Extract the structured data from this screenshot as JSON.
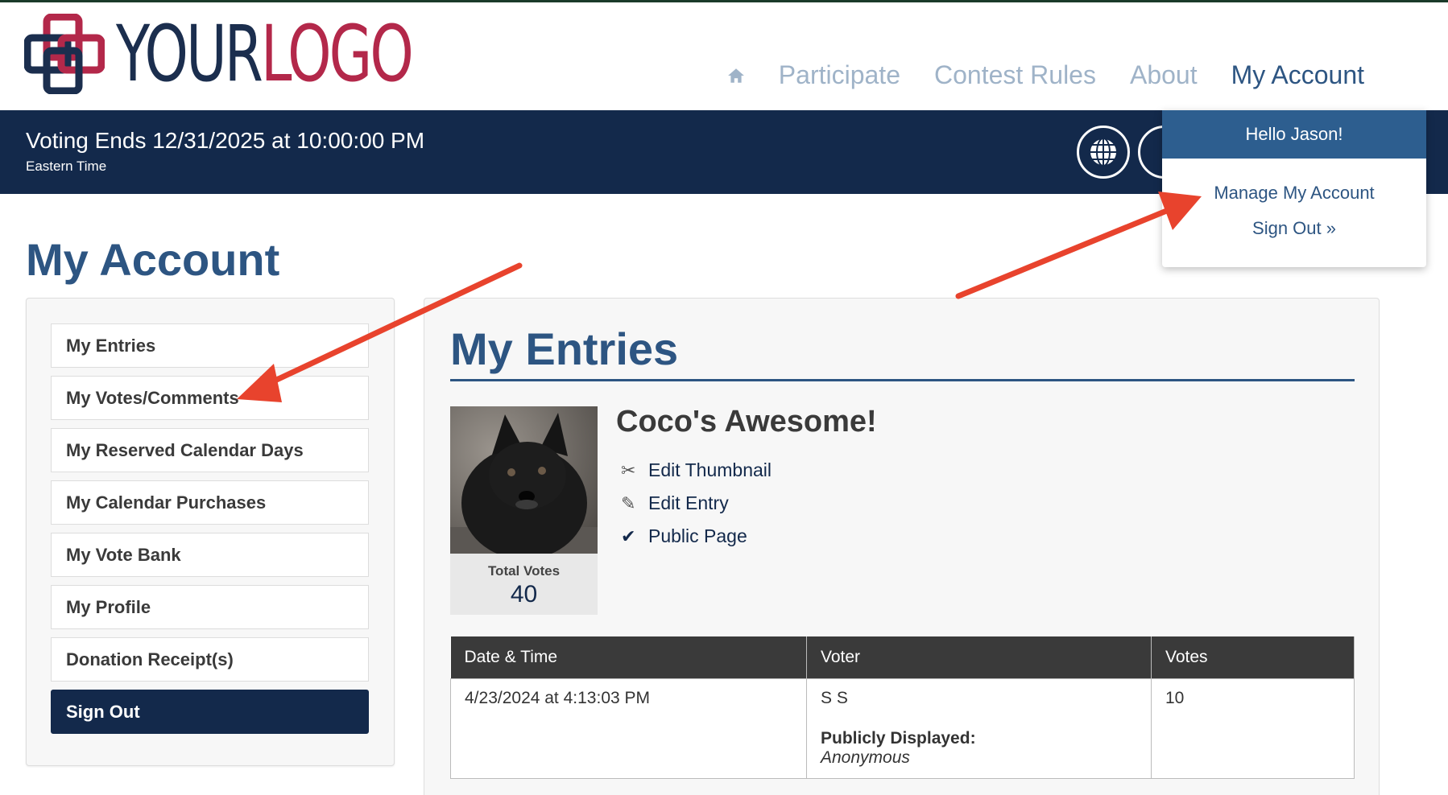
{
  "header": {
    "logo": {
      "part1": "YOUR",
      "part2": "LOGO"
    },
    "nav": [
      {
        "label": "Participate"
      },
      {
        "label": "Contest Rules"
      },
      {
        "label": "About"
      },
      {
        "label": "My Account"
      }
    ]
  },
  "banner": {
    "title": "Voting Ends 12/31/2025 at 10:00:00 PM",
    "subtitle": "Eastern Time"
  },
  "dropdown": {
    "greeting": "Hello Jason!",
    "items": [
      {
        "label": "Manage My Account"
      },
      {
        "label": "Sign Out »"
      }
    ]
  },
  "page": {
    "title": "My Account"
  },
  "sidebar": {
    "items": [
      {
        "label": "My Entries"
      },
      {
        "label": "My Votes/Comments"
      },
      {
        "label": "My Reserved Calendar Days"
      },
      {
        "label": "My Calendar Purchases"
      },
      {
        "label": "My Vote Bank"
      },
      {
        "label": "My Profile"
      },
      {
        "label": "Donation Receipt(s)"
      },
      {
        "label": "Sign Out"
      }
    ]
  },
  "entries": {
    "title": "My Entries",
    "entry": {
      "name": "Coco's Awesome!",
      "total_votes_label": "Total Votes",
      "total_votes": "40",
      "links": [
        {
          "label": "Edit Thumbnail",
          "icon": "scissors-icon"
        },
        {
          "label": "Edit Entry",
          "icon": "pencil-icon"
        },
        {
          "label": "Public Page",
          "icon": "checkmark-icon"
        }
      ]
    },
    "table": {
      "headers": [
        "Date & Time",
        "Voter",
        "Votes"
      ],
      "rows": [
        {
          "datetime": "4/23/2024 at 4:13:03 PM",
          "voter": "S S",
          "public_label": "Publicly Displayed:",
          "public_value": "Anonymous",
          "votes": "10"
        }
      ]
    }
  },
  "colors": {
    "navy": "#13294b",
    "blue": "#2d5582",
    "logo_red": "#b3284a",
    "arrow": "#e8432d"
  }
}
